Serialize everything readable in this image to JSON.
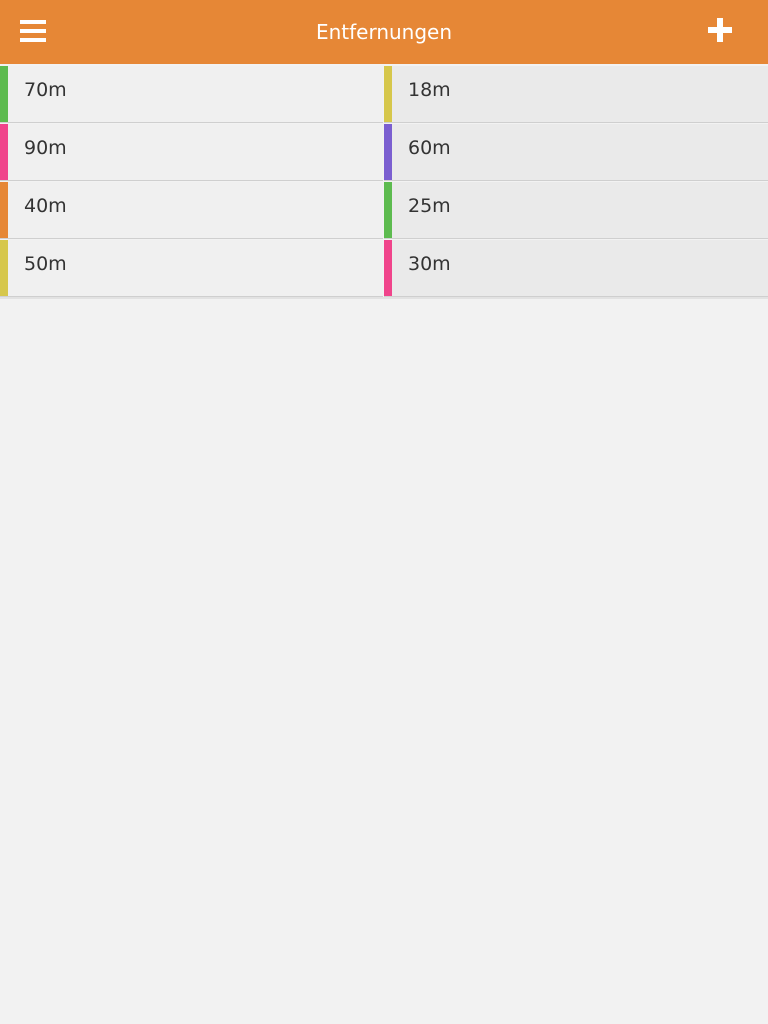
{
  "header": {
    "title": "Entfernungen",
    "menu_icon": "menu-icon",
    "add_icon": "plus-icon",
    "color": "#e68736"
  },
  "distances": {
    "left": [
      {
        "label": "70m",
        "color": "#5dbb4f"
      },
      {
        "label": "90m",
        "color": "#f0448b"
      },
      {
        "label": "40m",
        "color": "#e68736"
      },
      {
        "label": "50m",
        "color": "#d6c74b"
      }
    ],
    "right": [
      {
        "label": "18m",
        "color": "#d6c74b"
      },
      {
        "label": "60m",
        "color": "#7b5fd0"
      },
      {
        "label": "25m",
        "color": "#5dbb4f"
      },
      {
        "label": "30m",
        "color": "#f0448b"
      }
    ]
  }
}
